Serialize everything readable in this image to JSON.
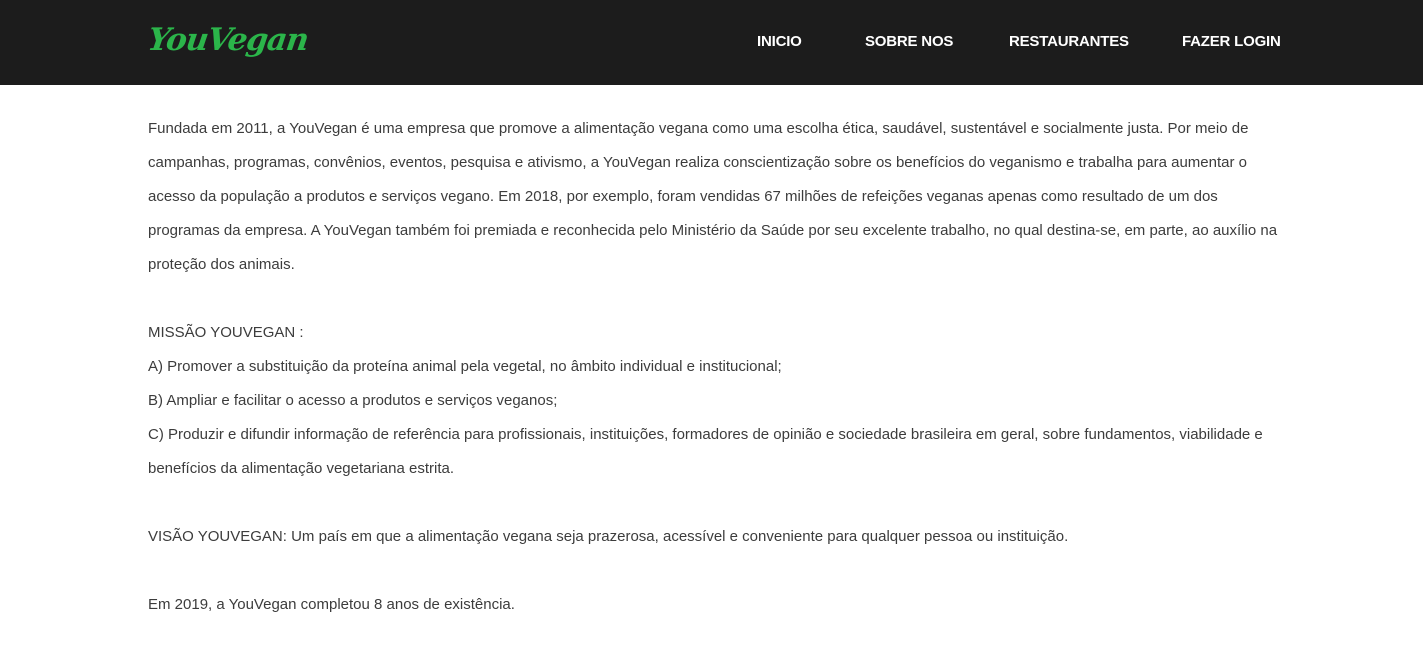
{
  "header": {
    "logo": "YouVegan",
    "nav": {
      "inicio": "INICIO",
      "sobre": "SOBRE NOS",
      "restaurantes": "RESTAURANTES",
      "login": "FAZER LOGIN"
    }
  },
  "main": {
    "intro": "Fundada em 2011, a YouVegan é uma empresa que promove a alimentação vegana como uma escolha ética, saudável, sustentável e socialmente justa. Por meio de campanhas, programas, convênios, eventos, pesquisa e ativismo, a YouVegan realiza conscientização sobre os benefícios do veganismo e trabalha para aumentar o acesso da população a produtos e serviços vegano. Em 2018, por exemplo, foram vendidas 67 milhões de refeições veganas apenas como resultado de um dos programas da empresa. A YouVegan também foi premiada e reconhecida pelo Ministério da Saúde por seu excelente trabalho, no qual destina-se, em parte, ao auxílio na proteção dos animais.",
    "mission_title": "MISSÃO YOUVEGAN :",
    "mission_items": [
      "A) Promover a substituição da proteína animal pela vegetal, no âmbito individual e institucional;",
      "B) Ampliar e facilitar o acesso a produtos e serviços veganos;",
      "C) Produzir e difundir informação de referência para profissionais, instituições, formadores de opinião e sociedade brasileira em geral, sobre fundamentos, viabilidade e benefícios da alimentação vegetariana estrita."
    ],
    "vision": "VISÃO YOUVEGAN: Um país em que a alimentação vegana seja prazerosa, acessível e conveniente para qualquer pessoa ou instituição.",
    "anniversary": "Em 2019, a YouVegan completou 8 anos de existência."
  },
  "colors": {
    "navbar_bg": "#1c1c1c",
    "logo": "#2bb54a",
    "nav_text": "#ffffff",
    "body_text": "#3c3c3c"
  }
}
